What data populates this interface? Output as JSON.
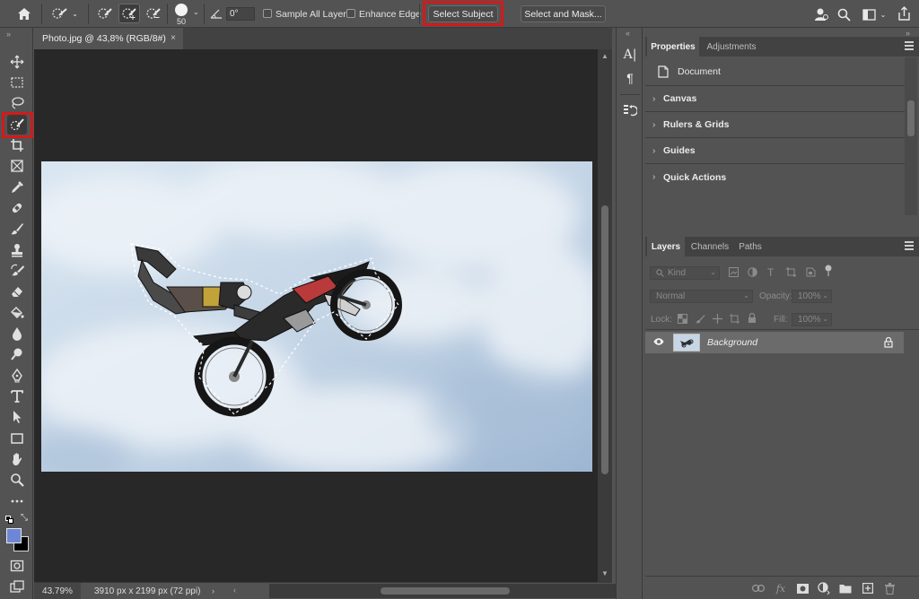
{
  "options_bar": {
    "brush_size": "50",
    "angle_value": "0°",
    "sample_all_layers": "Sample All Layers",
    "enhance_edge": "Enhance Edge",
    "select_subject": "Select Subject",
    "select_and_mask": "Select and Mask..."
  },
  "document": {
    "tab_title": "Photo.jpg @ 43,8% (RGB/8#)",
    "close_glyph": "×"
  },
  "status": {
    "zoom": "43.79%",
    "info": "3910 px x 2199 px (72 ppi)"
  },
  "properties_panel": {
    "tabs": [
      "Properties",
      "Adjustments"
    ],
    "document_label": "Document",
    "sections": [
      "Canvas",
      "Rulers & Grids",
      "Guides",
      "Quick Actions"
    ]
  },
  "layers_panel": {
    "tabs": [
      "Layers",
      "Channels",
      "Paths"
    ],
    "kind_label": "Kind",
    "blend_mode": "Normal",
    "opacity_label": "Opacity:",
    "opacity_value": "100%",
    "lock_label": "Lock:",
    "fill_label": "Fill:",
    "fill_value": "100%",
    "layers": [
      {
        "name": "Background",
        "visible": true,
        "locked": true
      }
    ]
  },
  "colors": {
    "foreground": "#6d86d6",
    "background": "#000000",
    "highlight": "#d31a1a"
  },
  "icons": {
    "toolbar": [
      "move-icon",
      "marquee-icon",
      "lasso-icon",
      "quick-selection-icon",
      "crop-icon",
      "frame-icon",
      "eyedropper-icon",
      "healing-brush-icon",
      "brush-icon",
      "stamp-icon",
      "history-brush-icon",
      "eraser-icon",
      "paint-bucket-icon",
      "blur-icon",
      "dodge-icon",
      "pen-icon",
      "type-icon",
      "path-selection-icon",
      "rectangle-icon",
      "hand-icon",
      "zoom-icon",
      "more-tools-icon"
    ]
  }
}
